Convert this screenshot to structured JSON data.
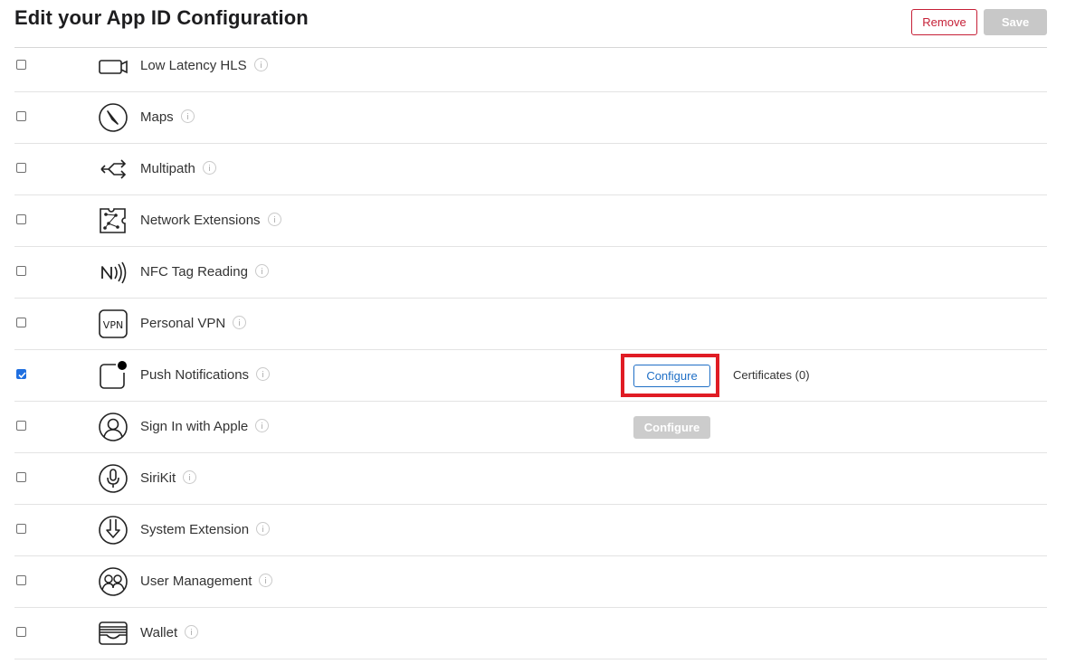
{
  "header": {
    "title": "Edit your App ID Configuration",
    "remove_label": "Remove",
    "save_label": "Save"
  },
  "capabilities": [
    {
      "name": "Low Latency HLS",
      "icon": "video-camera-icon",
      "checked": false
    },
    {
      "name": "Maps",
      "icon": "compass-icon",
      "checked": false
    },
    {
      "name": "Multipath",
      "icon": "multipath-arrows-icon",
      "checked": false
    },
    {
      "name": "Network Extensions",
      "icon": "network-extension-icon",
      "checked": false
    },
    {
      "name": "NFC Tag Reading",
      "icon": "nfc-icon",
      "checked": false
    },
    {
      "name": "Personal VPN",
      "icon": "vpn-icon",
      "checked": false
    },
    {
      "name": "Push Notifications",
      "icon": "push-notification-icon",
      "checked": true,
      "configure_label": "Configure",
      "certificates_label": "Certificates (0)"
    },
    {
      "name": "Sign In with Apple",
      "icon": "person-icon",
      "checked": false,
      "configure_label": "Configure"
    },
    {
      "name": "SiriKit",
      "icon": "microphone-icon",
      "checked": false
    },
    {
      "name": "System Extension",
      "icon": "system-extension-icon",
      "checked": false
    },
    {
      "name": "User Management",
      "icon": "users-icon",
      "checked": false
    },
    {
      "name": "Wallet",
      "icon": "wallet-icon",
      "checked": false
    }
  ],
  "colors": {
    "remove": "#c62037",
    "configure": "#1f6fc6",
    "highlight": "#e01c24",
    "checkbox_checked": "#1f6fe0"
  }
}
